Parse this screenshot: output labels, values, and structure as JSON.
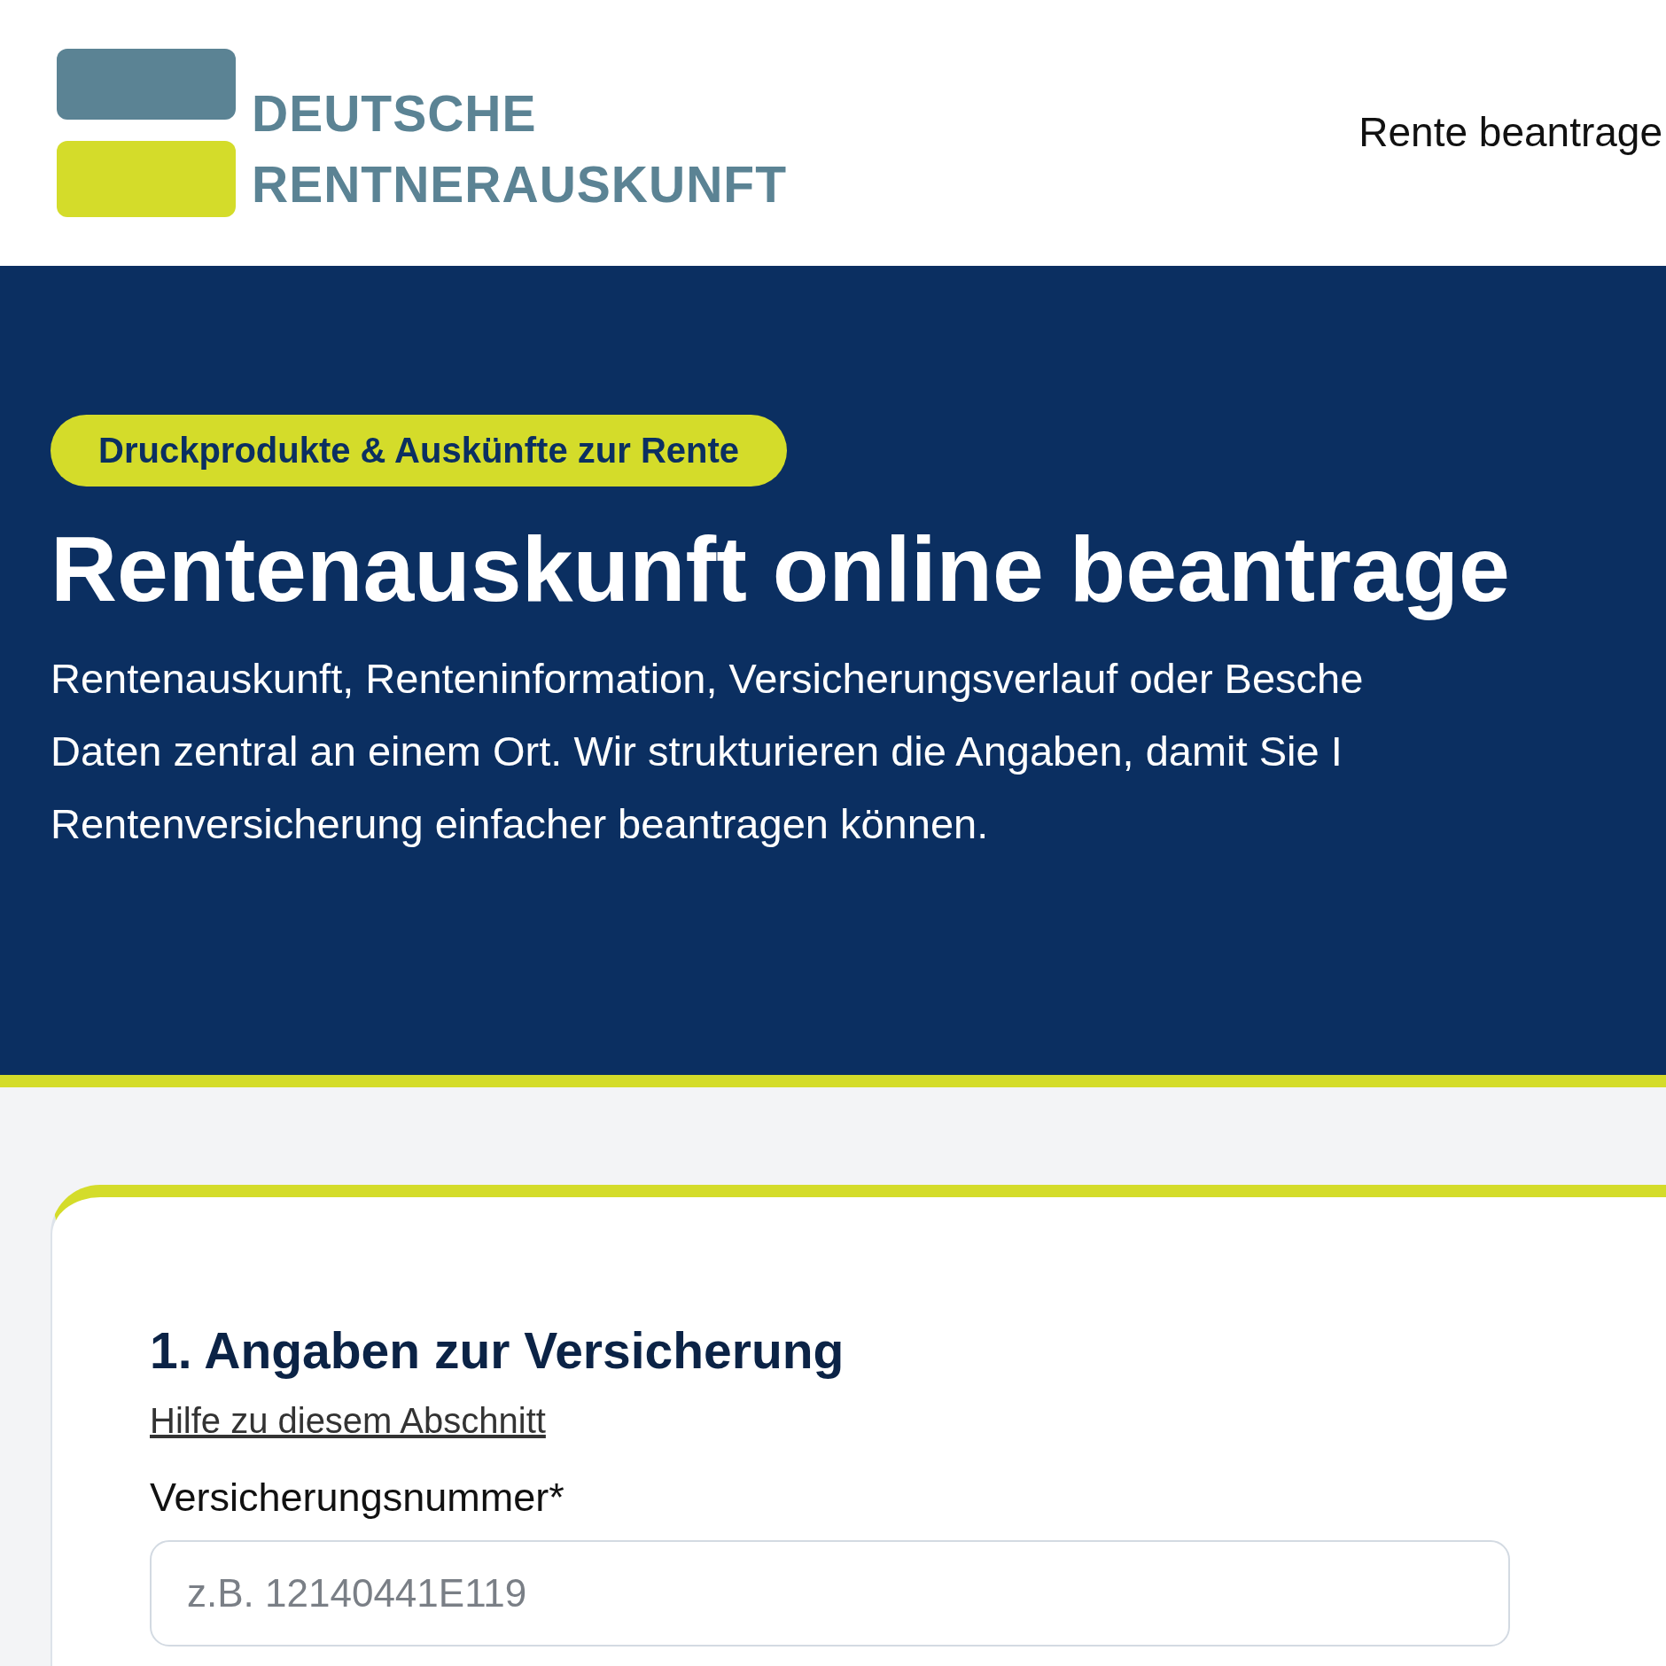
{
  "logo": {
    "line_1": "DEUTSCHE",
    "line_2": "RENTNERAUSKUNFT"
  },
  "nav": [
    {
      "label": "Rente beantrage"
    }
  ],
  "hero": {
    "badge": "Druckprodukte & Auskünfte zur Rente",
    "title": "Rentenauskunft online beantrage",
    "intro_lines": [
      "Rentenauskunft, Renteninformation, Versicherungsverlauf oder Besche",
      "Daten zentral an einem Ort. Wir strukturieren die Angaben, damit Sie I",
      "Rentenversicherung einfacher beantragen können."
    ]
  },
  "form": {
    "section_title": "1. Angaben zur Versicherung",
    "help_link": "Hilfe zu diesem Abschnitt",
    "fields": [
      {
        "label": "Versicherungsnummer*",
        "placeholder": "z.B. 12140441E119"
      }
    ]
  }
}
